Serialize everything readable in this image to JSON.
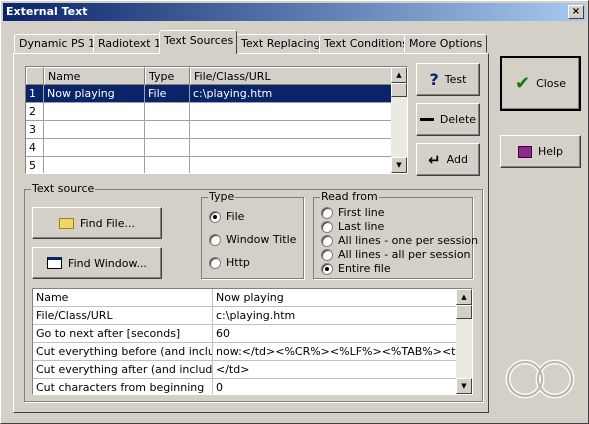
{
  "window": {
    "title": "External Text",
    "close_glyph": "×"
  },
  "tabs": [
    {
      "label": "Dynamic PS 1"
    },
    {
      "label": "Radiotext 1"
    },
    {
      "label": "Text Sources"
    },
    {
      "label": "Text Replacing"
    },
    {
      "label": "Text Conditions"
    },
    {
      "label": "More Options"
    }
  ],
  "active_tab": "Text Sources",
  "sources_table": {
    "columns": [
      "Name",
      "Type",
      "File/Class/URL"
    ],
    "rows": [
      {
        "num": "1",
        "name": "Now playing",
        "type": "File",
        "url": "c:\\playing.htm",
        "selected": true
      },
      {
        "num": "2",
        "name": "",
        "type": "",
        "url": ""
      },
      {
        "num": "3",
        "name": "",
        "type": "",
        "url": ""
      },
      {
        "num": "4",
        "name": "",
        "type": "",
        "url": ""
      },
      {
        "num": "5",
        "name": "",
        "type": "",
        "url": ""
      }
    ]
  },
  "side_buttons": {
    "test": "Test",
    "delete": "Delete",
    "add": "Add"
  },
  "right_buttons": {
    "close": "Close",
    "help": "Help"
  },
  "text_source": {
    "label": "Text source",
    "find_file": "Find File...",
    "find_window": "Find Window..."
  },
  "type_group": {
    "label": "Type",
    "options": [
      "File",
      "Window Title",
      "Http"
    ],
    "selected": "File"
  },
  "read_from_group": {
    "label": "Read from",
    "options": [
      "First line",
      "Last line",
      "All lines - one per session",
      "All lines - all per session",
      "Entire file"
    ],
    "selected": "Entire file"
  },
  "properties": [
    {
      "key": "Name",
      "value": "Now playing"
    },
    {
      "key": "File/Class/URL",
      "value": "c:\\playing.htm"
    },
    {
      "key": "Go to next after [seconds]",
      "value": "60"
    },
    {
      "key": "Cut everything before (and including)",
      "value": "now:</td><%CR%><%LF%><%TAB%><td>"
    },
    {
      "key": "Cut everything after (and including)",
      "value": "</td>"
    },
    {
      "key": "Cut characters from beginning",
      "value": "0"
    }
  ],
  "colors": {
    "selection": "#0a246a",
    "face": "#d4d0c8",
    "title_start": "#0a246a",
    "title_end": "#a6caf0"
  }
}
